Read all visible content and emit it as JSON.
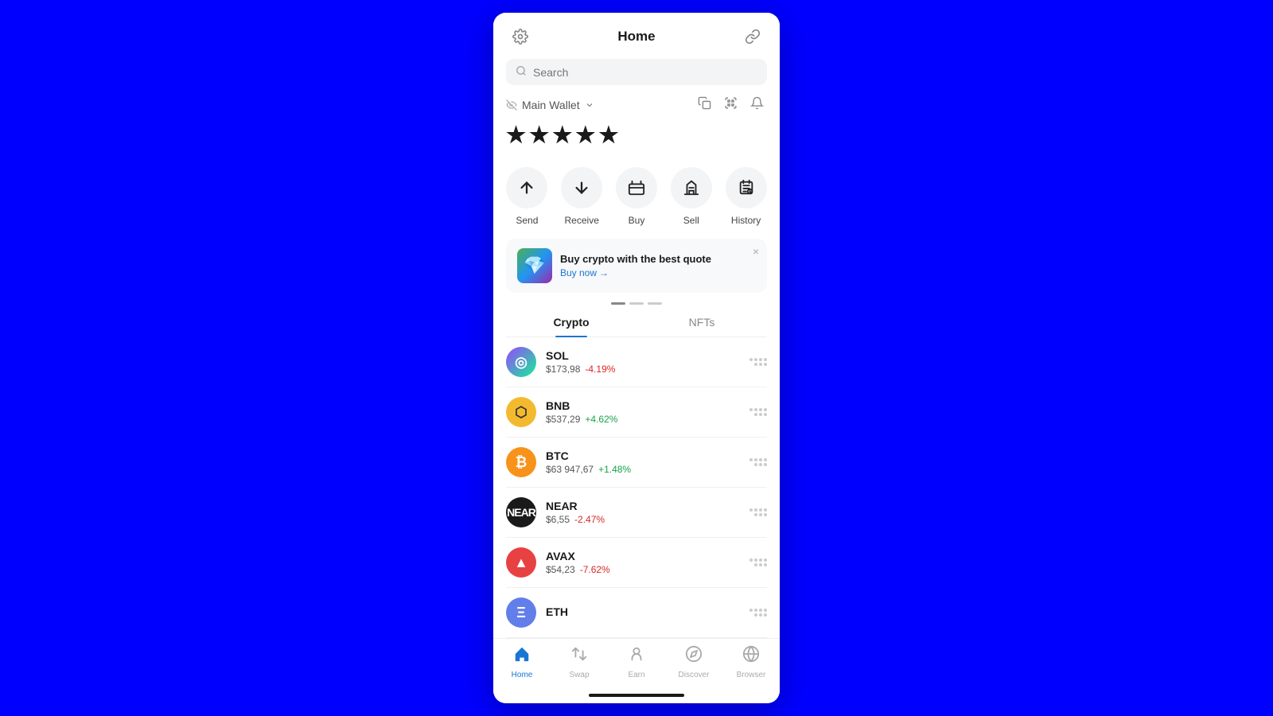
{
  "header": {
    "title": "Home",
    "settings_icon": "⚙",
    "link_icon": "🔗"
  },
  "search": {
    "placeholder": "Search"
  },
  "wallet": {
    "name": "Main Wallet",
    "balance_masked": "★★★★★",
    "balance_stars": "•••••"
  },
  "actions": [
    {
      "id": "send",
      "label": "Send",
      "icon": "↑"
    },
    {
      "id": "receive",
      "label": "Receive",
      "icon": "↓"
    },
    {
      "id": "buy",
      "label": "Buy",
      "icon": "≡"
    },
    {
      "id": "sell",
      "label": "Sell",
      "icon": "🏛"
    },
    {
      "id": "history",
      "label": "History",
      "icon": "📋"
    }
  ],
  "promo": {
    "title": "Buy crypto with the best quote",
    "link_label": "Buy now",
    "close_label": "×"
  },
  "tabs": [
    {
      "id": "crypto",
      "label": "Crypto",
      "active": true
    },
    {
      "id": "nfts",
      "label": "NFTs",
      "active": false
    }
  ],
  "crypto_list": [
    {
      "symbol": "SOL",
      "price": "$173,98",
      "change": "-4.19%",
      "positive": false,
      "color_class": "sol-logo",
      "letter": "◎"
    },
    {
      "symbol": "BNB",
      "price": "$537,29",
      "change": "+4.62%",
      "positive": true,
      "color_class": "bnb-logo",
      "letter": "⬡"
    },
    {
      "symbol": "BTC",
      "price": "$63 947,67",
      "change": "+1.48%",
      "positive": true,
      "color_class": "btc-logo",
      "letter": "₿"
    },
    {
      "symbol": "NEAR",
      "price": "$6,55",
      "change": "-2.47%",
      "positive": false,
      "color_class": "near-logo",
      "letter": "N"
    },
    {
      "symbol": "AVAX",
      "price": "$54,23",
      "change": "-7.62%",
      "positive": false,
      "color_class": "avax-logo",
      "letter": "▲"
    },
    {
      "symbol": "ETH",
      "price": "",
      "change": "",
      "positive": true,
      "color_class": "eth-logo",
      "letter": "Ξ"
    }
  ],
  "bottom_nav": [
    {
      "id": "home",
      "label": "Home",
      "active": true
    },
    {
      "id": "swap",
      "label": "Swap",
      "active": false
    },
    {
      "id": "earn",
      "label": "Earn",
      "active": false
    },
    {
      "id": "discover",
      "label": "Discover",
      "active": false
    },
    {
      "id": "browser",
      "label": "Browser",
      "active": false
    }
  ]
}
